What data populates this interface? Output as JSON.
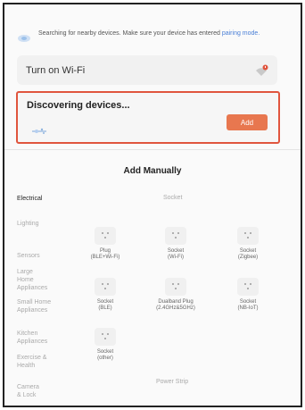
{
  "banner": {
    "text": "Searching for nearby devices. Make sure your device has entered ",
    "link": "pairing mode."
  },
  "wifi": {
    "label": "Turn on Wi-Fi"
  },
  "discover": {
    "title": "Discovering devices...",
    "add_label": "Add"
  },
  "manual": {
    "title": "Add Manually"
  },
  "sidebar": {
    "items": [
      {
        "label": "Electrical"
      },
      {
        "label": "Lighting"
      },
      {
        "label": "Sensors"
      },
      {
        "label": "Large Home Appliances"
      },
      {
        "label": "Small Home Appliances"
      },
      {
        "label": "Kitchen Appliances"
      },
      {
        "label": "Exercise & Health"
      },
      {
        "label": "Camera & Lock"
      }
    ]
  },
  "sections": {
    "socket": "Socket",
    "power_strip": "Power Strip"
  },
  "devices": [
    {
      "name": "Plug",
      "sub": "(BLE+Wi-Fi)"
    },
    {
      "name": "Socket",
      "sub": "(Wi-Fi)"
    },
    {
      "name": "Socket",
      "sub": "(Zigbee)"
    },
    {
      "name": "Socket",
      "sub": "(BLE)"
    },
    {
      "name": "Dualband Plug",
      "sub": "(2.4GHz&5GHz)"
    },
    {
      "name": "Socket",
      "sub": "(NB-IoT)"
    },
    {
      "name": "Socket",
      "sub": "(other)"
    }
  ],
  "colors": {
    "accent": "#e8774f",
    "highlight_border": "#e0553e",
    "link": "#4a7fd6"
  }
}
